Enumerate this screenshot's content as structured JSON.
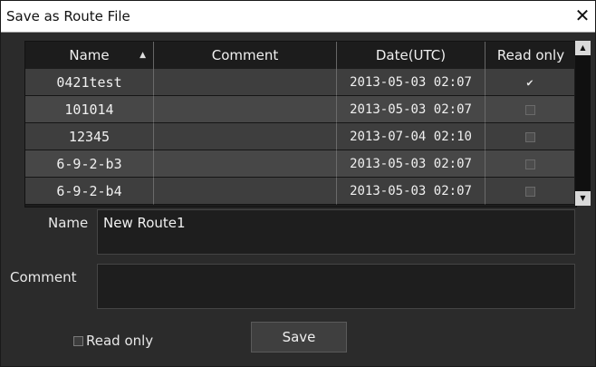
{
  "dialog": {
    "title": "Save as Route File",
    "close_glyph": "✕"
  },
  "table": {
    "headers": {
      "name": "Name",
      "comment": "Comment",
      "date": "Date(UTC)",
      "read_only": "Read only"
    },
    "sort_glyph": "▲",
    "rows": [
      {
        "name": "0421test",
        "comment": "",
        "date": "2013-05-03 02:07",
        "read_only": true
      },
      {
        "name": "101014",
        "comment": "",
        "date": "2013-05-03 02:07",
        "read_only": false
      },
      {
        "name": "12345",
        "comment": "",
        "date": "2013-07-04 02:10",
        "read_only": false
      },
      {
        "name": "6-9-2-b3",
        "comment": "",
        "date": "2013-05-03 02:07",
        "read_only": false
      },
      {
        "name": "6-9-2-b4",
        "comment": "",
        "date": "2013-05-03 02:07",
        "read_only": false
      }
    ],
    "check_glyph": "✔"
  },
  "scrollbar": {
    "up_glyph": "▲",
    "down_glyph": "▼"
  },
  "form": {
    "name_label": "Name",
    "name_value": "New Route1",
    "comment_label": "Comment",
    "comment_value": "",
    "read_only_label": "Read only",
    "read_only_checked": false,
    "save_label": "Save"
  },
  "icons": {
    "close": "close-icon",
    "sort": "sort-ascending-icon",
    "scroll_up": "chevron-up-icon",
    "scroll_down": "chevron-down-icon",
    "check": "checkmark-icon"
  }
}
